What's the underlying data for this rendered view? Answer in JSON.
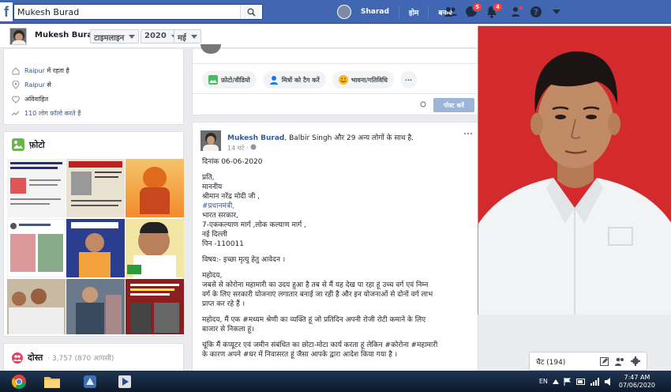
{
  "topbar": {
    "logo": "f",
    "search_value": "Mukesh Burad",
    "user_name": "Sharad",
    "home_label": "होम",
    "create_label": "बनाएँ",
    "messages_badge": "5",
    "notifications_badge": "4"
  },
  "subbar": {
    "name": "Mukesh Burad",
    "timeline": "टाइमलाइन",
    "year": "2020",
    "month": "मई"
  },
  "intro": {
    "lives_in_city": "Raipur",
    "lives_in_suffix": "में रहता है",
    "from_city": "Raipur",
    "from_suffix": "से",
    "relationship": "अविवाहित",
    "followers": "110 लोग फ़ॉलो करते हैं"
  },
  "photos": {
    "title": "फ़ोटो"
  },
  "friends": {
    "title": "दोस्त",
    "count": "· 3,757 (870 आपसी)"
  },
  "composer": {
    "photo_video": "फ़ोटो/वीडियो",
    "tag_friends": "मित्रों को टैग करें",
    "feeling": "भावना/गतिविधि",
    "more": "···",
    "post": "पोस्ट करें"
  },
  "post": {
    "author": "Mukesh Burad",
    "with_text": ", Balbir Singh और 29 अन्य लोगों के साथ है.",
    "time": "14 घंटे · ",
    "lines": [
      "दिनांक 06-06-2020",
      "प्रति,",
      "माननीय",
      "श्रीमान नरेंद्र मोदी जी ,",
      "#प्रधानमंत्री,",
      "भारत सरकार,",
      "7-एककल्याण मार्ग ,लोक कल्याण मार्ग ,",
      "नई दिल्ली",
      "पिन -110011",
      "विषय:- इच्छा मृत्यु हेतु आवेदन ।",
      "महोदय,",
      "जबसे से कोरोना महामारी का उदय हुआ है तब से मैं यह देख पा रहा हूं उच्च वर्ग एवं निम्न",
      "वर्ग के लिए सरकारी योजनाएं लगातार बनाई जा रही है और इन योजनाओं से दोनों वर्ग लाभ",
      "प्राप्त कर रहे हैं ।",
      "महोदय, मैं एक #मध्यम श्रेणी का व्यक्ति हूं जो प्रतिदिन अपनी रोजी रोटी कमाने के लिए",
      "बाजार से निकला हूं।",
      "चूंकि मैं कंप्यूटर एवं जमीन संबंधित का छोटा-मोटा कार्य करता हूं लेकिन #कोरोना #महामारी",
      "के कारण अपने #घर में निवासरत हूं जैसा आपके द्वारा आदेश किया गया है ।"
    ]
  },
  "chat": {
    "label": "चैट (194)"
  },
  "taskbar": {
    "lang": "EN",
    "time": "7:47 AM",
    "date": "07/06/2020"
  }
}
